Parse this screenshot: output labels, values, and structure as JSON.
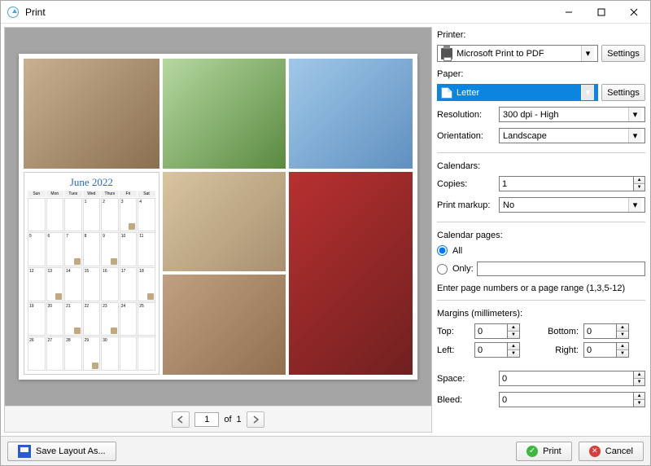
{
  "window": {
    "title": "Print"
  },
  "printer": {
    "label": "Printer:",
    "selected": "Microsoft Print to PDF",
    "settings_btn": "Settings"
  },
  "paper": {
    "label": "Paper:",
    "selected": "Letter",
    "settings_btn": "Settings"
  },
  "resolution": {
    "label": "Resolution:",
    "value": "300 dpi - High"
  },
  "orientation": {
    "label": "Orientation:",
    "value": "Landscape"
  },
  "calendars": {
    "label": "Calendars:",
    "copies_label": "Copies:",
    "copies_value": "1",
    "markup_label": "Print markup:",
    "markup_value": "No"
  },
  "pages": {
    "label": "Calendar pages:",
    "all_label": "All",
    "only_label": "Only:",
    "only_value": "",
    "hint": "Enter page numbers or a page range (1,3,5-12)"
  },
  "margins": {
    "label": "Margins (millimeters):",
    "top_label": "Top:",
    "top_value": "0",
    "bottom_label": "Bottom:",
    "bottom_value": "0",
    "left_label": "Left:",
    "left_value": "0",
    "right_label": "Right:",
    "right_value": "0",
    "space_label": "Space:",
    "space_value": "0",
    "bleed_label": "Bleed:",
    "bleed_value": "0"
  },
  "preview": {
    "cal_title": "June 2022",
    "days": [
      "Sun",
      "Mon",
      "Tues",
      "Wed",
      "Thurs",
      "Fri",
      "Sat"
    ]
  },
  "pager": {
    "current": "1",
    "of_label": "of",
    "total": "1"
  },
  "footer": {
    "save_label": "Save Layout As...",
    "print_label": "Print",
    "cancel_label": "Cancel"
  }
}
